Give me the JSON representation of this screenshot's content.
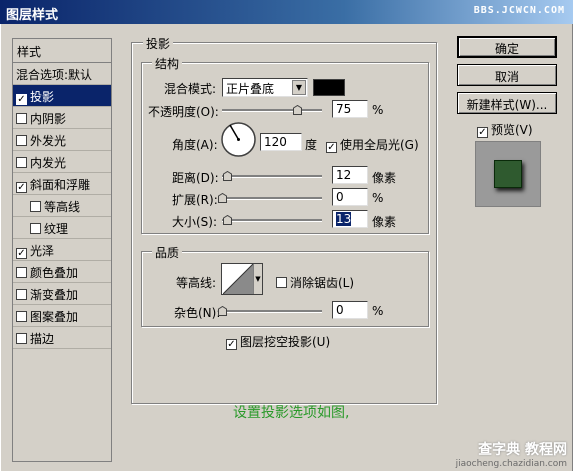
{
  "window": {
    "title": "图层样式",
    "watermark": "BBS.JCWCN.COM"
  },
  "sidebar": {
    "header": "样式",
    "items": [
      {
        "label": "混合选项:默认",
        "checkbox": false,
        "checked": false,
        "indent": false,
        "selected": false
      },
      {
        "label": "投影",
        "checkbox": true,
        "checked": true,
        "indent": false,
        "selected": true
      },
      {
        "label": "内阴影",
        "checkbox": true,
        "checked": false,
        "indent": false,
        "selected": false
      },
      {
        "label": "外发光",
        "checkbox": true,
        "checked": false,
        "indent": false,
        "selected": false
      },
      {
        "label": "内发光",
        "checkbox": true,
        "checked": false,
        "indent": false,
        "selected": false
      },
      {
        "label": "斜面和浮雕",
        "checkbox": true,
        "checked": true,
        "indent": false,
        "selected": false
      },
      {
        "label": "等高线",
        "checkbox": true,
        "checked": false,
        "indent": true,
        "selected": false
      },
      {
        "label": "纹理",
        "checkbox": true,
        "checked": false,
        "indent": true,
        "selected": false
      },
      {
        "label": "光泽",
        "checkbox": true,
        "checked": true,
        "indent": false,
        "selected": false
      },
      {
        "label": "颜色叠加",
        "checkbox": true,
        "checked": false,
        "indent": false,
        "selected": false
      },
      {
        "label": "渐变叠加",
        "checkbox": true,
        "checked": false,
        "indent": false,
        "selected": false
      },
      {
        "label": "图案叠加",
        "checkbox": true,
        "checked": false,
        "indent": false,
        "selected": false
      },
      {
        "label": "描边",
        "checkbox": true,
        "checked": false,
        "indent": false,
        "selected": false
      }
    ]
  },
  "shadow": {
    "group_title": "投影",
    "structure_title": "结构",
    "blend_mode_label": "混合模式:",
    "blend_mode_value": "正片叠底",
    "shadow_color": "#000000",
    "opacity_label": "不透明度(O):",
    "opacity_value": "75",
    "opacity_fraction": 0.75,
    "percent": "%",
    "angle_label": "角度(A):",
    "angle_value": "120",
    "degree_unit": "度",
    "global_light_label": "使用全局光(G)",
    "global_light_checked": true,
    "distance_label": "距离(D):",
    "distance_value": "12",
    "distance_fraction": 0.05,
    "pixel_unit": "像素",
    "spread_label": "扩展(R):",
    "spread_value": "0",
    "spread_fraction": 0,
    "size_label": "大小(S):",
    "size_value": "13",
    "size_fraction": 0.05
  },
  "quality": {
    "title": "品质",
    "contour_label": "等高线:",
    "antialias_label": "消除锯齿(L)",
    "antialias_checked": false,
    "noise_label": "杂色(N):",
    "noise_value": "0",
    "noise_fraction": 0,
    "knockout_label": "图层挖空投影(U)",
    "knockout_checked": true
  },
  "buttons": {
    "ok": "确定",
    "cancel": "取消",
    "new_style": "新建样式(W)...",
    "preview_label": "预览(V)",
    "preview_checked": true
  },
  "note": "设置投影选项如图,",
  "bottom_watermark": {
    "brand": "查字典 教程网",
    "url": "jiaocheng.chazidian.com"
  }
}
